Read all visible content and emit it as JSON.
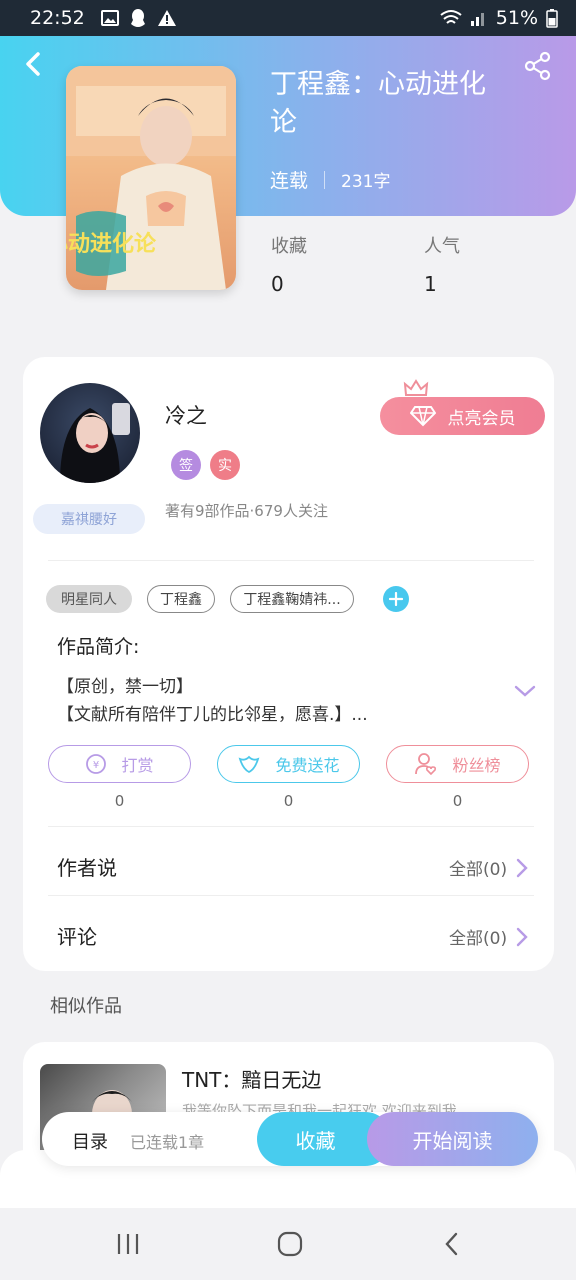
{
  "status_bar": {
    "time": "22:52",
    "battery": "51%"
  },
  "book": {
    "title": "丁程鑫：心动进化论",
    "status": "连载",
    "word_count": "231字",
    "stats": [
      {
        "label": "收藏",
        "value": "0"
      },
      {
        "label": "人气",
        "value": "1"
      }
    ],
    "cover_text": "心动进化论"
  },
  "author": {
    "name": "冷之",
    "badges": [
      "签",
      "实"
    ],
    "fan_tag": "嘉祺腰好",
    "meta": "著有9部作品·679人关注",
    "vip_button": "点亮会员"
  },
  "tags": [
    "明星同人",
    "丁程鑫",
    "丁程鑫鞠婧祎..."
  ],
  "intro": {
    "label": "作品简介:",
    "lines": [
      "【原创，禁一切】",
      "【文献所有陪伴丁儿的比邻星，愿喜.】..."
    ]
  },
  "actions": [
    {
      "label": "打赏",
      "count": "0",
      "color": "#b79be6"
    },
    {
      "label": "免费送花",
      "count": "0",
      "color": "#4cc8ea"
    },
    {
      "label": "粉丝榜",
      "count": "0",
      "color": "#ef8f9a"
    }
  ],
  "rows": [
    {
      "label": "作者说",
      "right": "全部(0)"
    },
    {
      "label": "评论",
      "right": "全部(0)"
    }
  ],
  "similar": {
    "heading": "相似作品",
    "items": [
      {
        "title": "TNT：黯日无边",
        "desc": "我等你坠下而是和我一起狂欢,欢迎来到我"
      }
    ]
  },
  "bottom_bar": {
    "toc": "目录",
    "toc_sub": "已连载1章",
    "collect": "收藏",
    "read": "开始阅读"
  },
  "colors": {
    "accent_blue": "#48ccee",
    "accent_purple": "#b89ae7",
    "vip_pink": "#ef7d93"
  }
}
